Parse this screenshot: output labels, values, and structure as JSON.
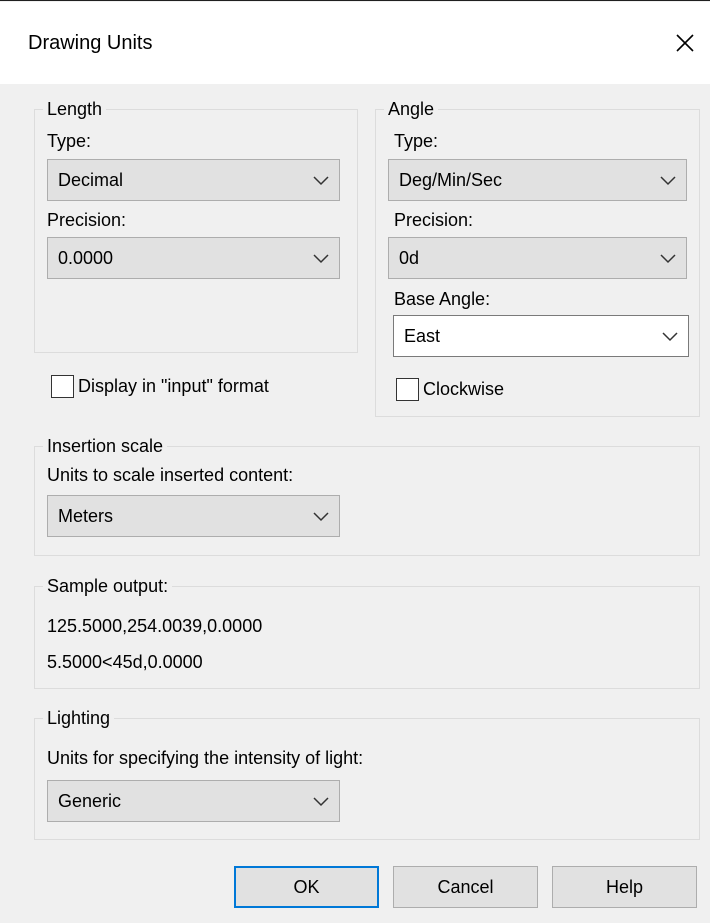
{
  "window": {
    "title": "Drawing Units",
    "close_icon": "close-icon"
  },
  "length": {
    "legend": "Length",
    "type_label": "Type:",
    "type_value": "Decimal",
    "precision_label": "Precision:",
    "precision_value": "0.0000",
    "display_input_label": "Display in \"input\" format",
    "display_input_checked": false
  },
  "angle": {
    "legend": "Angle",
    "type_label": "Type:",
    "type_value": "Deg/Min/Sec",
    "precision_label": "Precision:",
    "precision_value": "0d",
    "base_angle_label": "Base Angle:",
    "base_angle_value": "East",
    "clockwise_label": "Clockwise",
    "clockwise_checked": false
  },
  "insertion_scale": {
    "legend": "Insertion scale",
    "units_label": "Units to scale inserted content:",
    "units_value": "Meters"
  },
  "sample_output": {
    "legend": "Sample output:",
    "line1": "125.5000,254.0039,0.0000",
    "line2": "5.5000<45d,0.0000"
  },
  "lighting": {
    "legend": "Lighting",
    "units_label": "Units for specifying the intensity of light:",
    "units_value": "Generic"
  },
  "buttons": {
    "ok": "OK",
    "cancel": "Cancel",
    "help": "Help"
  },
  "colors": {
    "dialog_bg": "#f0f0f0",
    "control_bg": "#e1e1e1",
    "accent": "#0078d7"
  }
}
